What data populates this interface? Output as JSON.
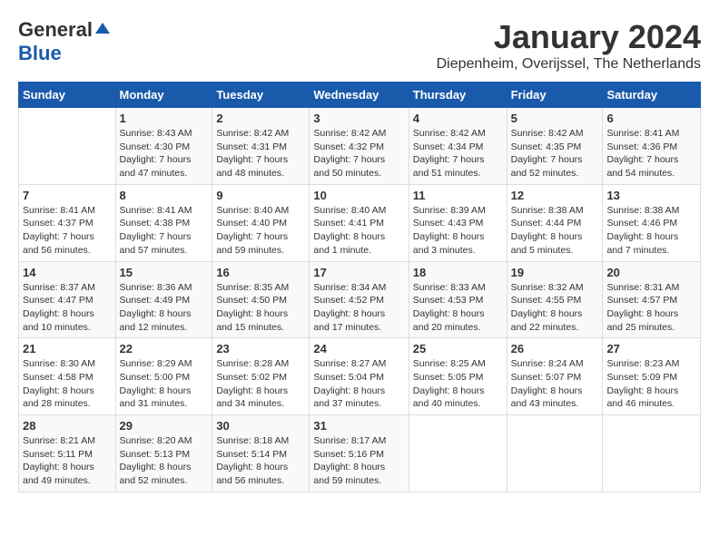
{
  "header": {
    "logo_general": "General",
    "logo_blue": "Blue",
    "month_title": "January 2024",
    "location": "Diepenheim, Overijssel, The Netherlands"
  },
  "days_of_week": [
    "Sunday",
    "Monday",
    "Tuesday",
    "Wednesday",
    "Thursday",
    "Friday",
    "Saturday"
  ],
  "weeks": [
    [
      {
        "day": "",
        "info": ""
      },
      {
        "day": "1",
        "info": "Sunrise: 8:43 AM\nSunset: 4:30 PM\nDaylight: 7 hours\nand 47 minutes."
      },
      {
        "day": "2",
        "info": "Sunrise: 8:42 AM\nSunset: 4:31 PM\nDaylight: 7 hours\nand 48 minutes."
      },
      {
        "day": "3",
        "info": "Sunrise: 8:42 AM\nSunset: 4:32 PM\nDaylight: 7 hours\nand 50 minutes."
      },
      {
        "day": "4",
        "info": "Sunrise: 8:42 AM\nSunset: 4:34 PM\nDaylight: 7 hours\nand 51 minutes."
      },
      {
        "day": "5",
        "info": "Sunrise: 8:42 AM\nSunset: 4:35 PM\nDaylight: 7 hours\nand 52 minutes."
      },
      {
        "day": "6",
        "info": "Sunrise: 8:41 AM\nSunset: 4:36 PM\nDaylight: 7 hours\nand 54 minutes."
      }
    ],
    [
      {
        "day": "7",
        "info": "Sunrise: 8:41 AM\nSunset: 4:37 PM\nDaylight: 7 hours\nand 56 minutes."
      },
      {
        "day": "8",
        "info": "Sunrise: 8:41 AM\nSunset: 4:38 PM\nDaylight: 7 hours\nand 57 minutes."
      },
      {
        "day": "9",
        "info": "Sunrise: 8:40 AM\nSunset: 4:40 PM\nDaylight: 7 hours\nand 59 minutes."
      },
      {
        "day": "10",
        "info": "Sunrise: 8:40 AM\nSunset: 4:41 PM\nDaylight: 8 hours\nand 1 minute."
      },
      {
        "day": "11",
        "info": "Sunrise: 8:39 AM\nSunset: 4:43 PM\nDaylight: 8 hours\nand 3 minutes."
      },
      {
        "day": "12",
        "info": "Sunrise: 8:38 AM\nSunset: 4:44 PM\nDaylight: 8 hours\nand 5 minutes."
      },
      {
        "day": "13",
        "info": "Sunrise: 8:38 AM\nSunset: 4:46 PM\nDaylight: 8 hours\nand 7 minutes."
      }
    ],
    [
      {
        "day": "14",
        "info": "Sunrise: 8:37 AM\nSunset: 4:47 PM\nDaylight: 8 hours\nand 10 minutes."
      },
      {
        "day": "15",
        "info": "Sunrise: 8:36 AM\nSunset: 4:49 PM\nDaylight: 8 hours\nand 12 minutes."
      },
      {
        "day": "16",
        "info": "Sunrise: 8:35 AM\nSunset: 4:50 PM\nDaylight: 8 hours\nand 15 minutes."
      },
      {
        "day": "17",
        "info": "Sunrise: 8:34 AM\nSunset: 4:52 PM\nDaylight: 8 hours\nand 17 minutes."
      },
      {
        "day": "18",
        "info": "Sunrise: 8:33 AM\nSunset: 4:53 PM\nDaylight: 8 hours\nand 20 minutes."
      },
      {
        "day": "19",
        "info": "Sunrise: 8:32 AM\nSunset: 4:55 PM\nDaylight: 8 hours\nand 22 minutes."
      },
      {
        "day": "20",
        "info": "Sunrise: 8:31 AM\nSunset: 4:57 PM\nDaylight: 8 hours\nand 25 minutes."
      }
    ],
    [
      {
        "day": "21",
        "info": "Sunrise: 8:30 AM\nSunset: 4:58 PM\nDaylight: 8 hours\nand 28 minutes."
      },
      {
        "day": "22",
        "info": "Sunrise: 8:29 AM\nSunset: 5:00 PM\nDaylight: 8 hours\nand 31 minutes."
      },
      {
        "day": "23",
        "info": "Sunrise: 8:28 AM\nSunset: 5:02 PM\nDaylight: 8 hours\nand 34 minutes."
      },
      {
        "day": "24",
        "info": "Sunrise: 8:27 AM\nSunset: 5:04 PM\nDaylight: 8 hours\nand 37 minutes."
      },
      {
        "day": "25",
        "info": "Sunrise: 8:25 AM\nSunset: 5:05 PM\nDaylight: 8 hours\nand 40 minutes."
      },
      {
        "day": "26",
        "info": "Sunrise: 8:24 AM\nSunset: 5:07 PM\nDaylight: 8 hours\nand 43 minutes."
      },
      {
        "day": "27",
        "info": "Sunrise: 8:23 AM\nSunset: 5:09 PM\nDaylight: 8 hours\nand 46 minutes."
      }
    ],
    [
      {
        "day": "28",
        "info": "Sunrise: 8:21 AM\nSunset: 5:11 PM\nDaylight: 8 hours\nand 49 minutes."
      },
      {
        "day": "29",
        "info": "Sunrise: 8:20 AM\nSunset: 5:13 PM\nDaylight: 8 hours\nand 52 minutes."
      },
      {
        "day": "30",
        "info": "Sunrise: 8:18 AM\nSunset: 5:14 PM\nDaylight: 8 hours\nand 56 minutes."
      },
      {
        "day": "31",
        "info": "Sunrise: 8:17 AM\nSunset: 5:16 PM\nDaylight: 8 hours\nand 59 minutes."
      },
      {
        "day": "",
        "info": ""
      },
      {
        "day": "",
        "info": ""
      },
      {
        "day": "",
        "info": ""
      }
    ]
  ]
}
